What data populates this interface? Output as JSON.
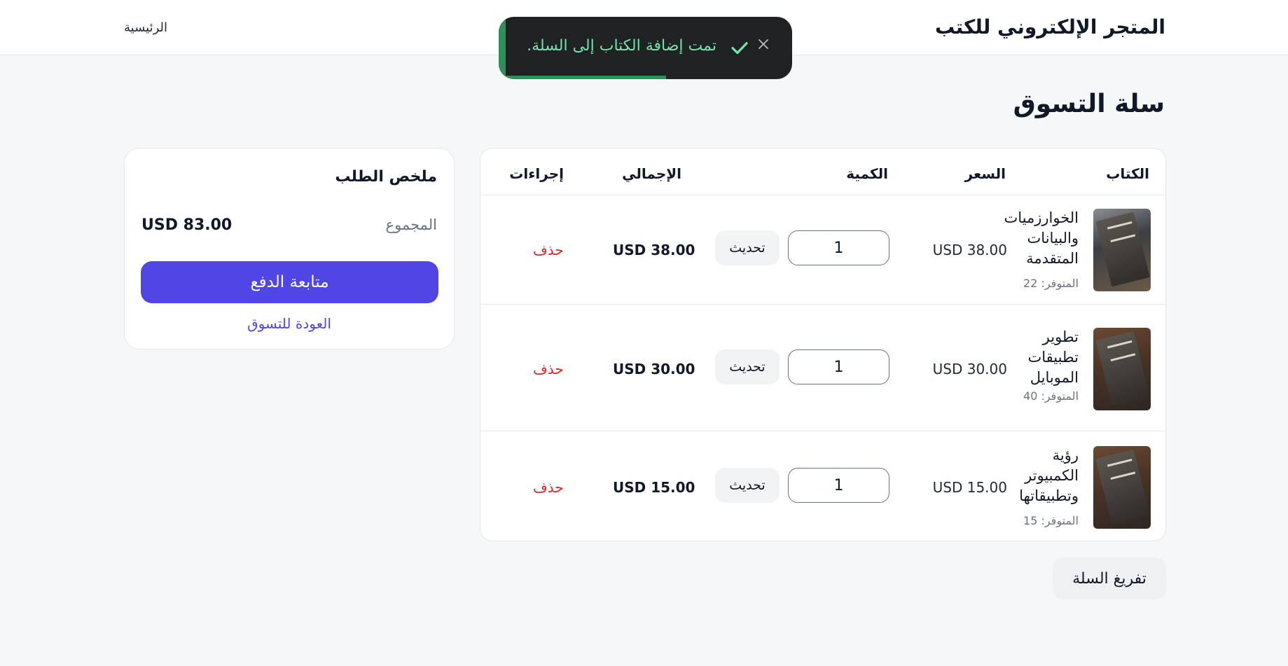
{
  "header": {
    "brand": "المتجر الإلكتروني للكتب",
    "home_link": "الرئيسية"
  },
  "toast": {
    "message": "تمت إضافة الكتاب إلى السلة.",
    "icon": "check-icon",
    "close_icon": "close-icon",
    "progress_percent": 57,
    "accent_color": "#2f8f5b"
  },
  "cart": {
    "title": "سلة التسوق",
    "columns": {
      "book": "الكتاب",
      "price": "السعر",
      "quantity": "الكمية",
      "total": "الإجمالي",
      "actions": "إجراءات"
    },
    "items": [
      {
        "title": "الخوارزميات والبيانات المتقدمة",
        "stock": "المتوفر: 22",
        "price": "USD 38.00",
        "quantity": "1",
        "update_label": "تحديث",
        "total": "USD 38.00",
        "remove_label": "حذف"
      },
      {
        "title": "تطوير تطبيقات الموبايل",
        "stock": "المتوفر: 40",
        "price": "USD 30.00",
        "quantity": "1",
        "update_label": "تحديث",
        "total": "USD 30.00",
        "remove_label": "حذف"
      },
      {
        "title": "رؤية الكمبيوتر وتطبيقاتها",
        "stock": "المتوفر: 15",
        "price": "USD 15.00",
        "quantity": "1",
        "update_label": "تحديث",
        "total": "USD 15.00",
        "remove_label": "حذف"
      }
    ],
    "clear_label": "تفريغ السلة"
  },
  "summary": {
    "title": "ملخص الطلب",
    "subtotal_label": "المجموع",
    "subtotal_value": "USD 83.00",
    "checkout_label": "متابعة الدفع",
    "back_label": "العودة للتسوق"
  },
  "colors": {
    "primary": "#4f46e5",
    "danger": "#dc2626",
    "toast_text": "#6ee7a8"
  }
}
